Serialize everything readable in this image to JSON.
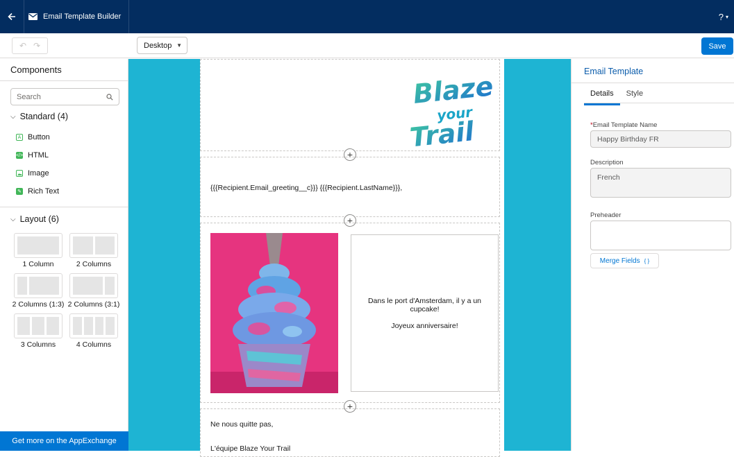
{
  "topbar": {
    "title": "Email Template Builder",
    "help_label": "?"
  },
  "toolbar": {
    "view_value": "Desktop",
    "save_label": "Save"
  },
  "components": {
    "header": "Components",
    "search_placeholder": "Search",
    "standard_title": "Standard (4)",
    "standard_items": [
      "Button",
      "HTML",
      "Image",
      "Rich Text"
    ],
    "layout_title": "Layout (6)",
    "layout_items": [
      "1 Column",
      "2 Columns",
      "2 Columns (1:3)",
      "2 Columns (3:1)",
      "3 Columns",
      "4 Columns"
    ],
    "appexchange_label": "Get more on the AppExchange"
  },
  "email": {
    "logo_lines": [
      "Blaze",
      "your",
      "Trail"
    ],
    "greeting": "{{{Recipient.Email_greeting__c}}} {{{Recipient.LastName}}},",
    "body_line1": "Dans le port d'Amsterdam, il y a un cupcake!",
    "body_line2": "Joyeux anniversaire!",
    "sign_line1": "Ne nous quitte pas,",
    "sign_line2": "L'équipe Blaze Your Trail"
  },
  "properties": {
    "title": "Email Template",
    "tabs": [
      "Details",
      "Style"
    ],
    "name_label": "Email Template Name",
    "name_value": "Happy Birthday FR",
    "description_label": "Description",
    "description_value": "French",
    "preheader_label": "Preheader",
    "preheader_value": "",
    "merge_fields_label": "Merge Fields"
  },
  "colors": {
    "header_bg": "#032d60",
    "brand_blue": "#0176d3",
    "canvas_bg": "#1eb4d3",
    "component_green": "#41b658"
  }
}
